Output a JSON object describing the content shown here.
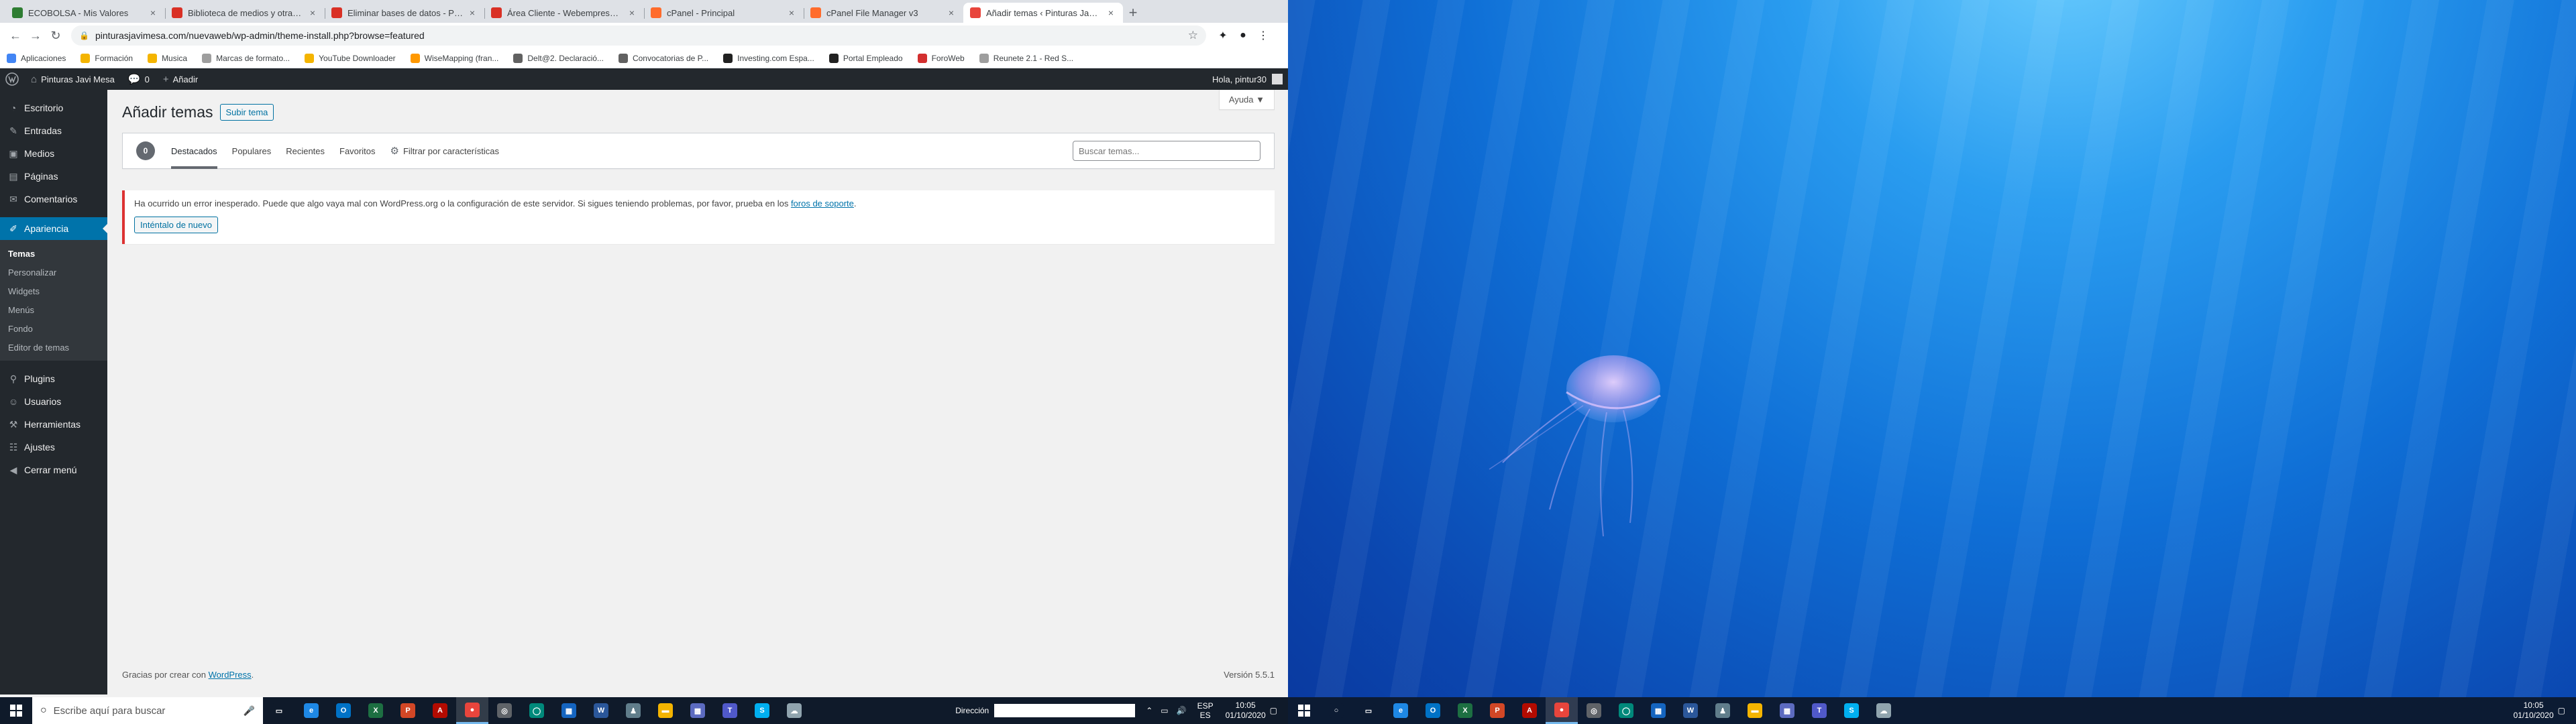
{
  "browser": {
    "tabs": [
      {
        "title": "ECOBOLSA - Mis Valores",
        "color": "#2e7d32"
      },
      {
        "title": "Biblioteca de medios y otras fu...",
        "color": "#d93025"
      },
      {
        "title": "Eliminar bases de datos - Pregu...",
        "color": "#d93025"
      },
      {
        "title": "Área Cliente - Webempresa Eur...",
        "color": "#d93025"
      },
      {
        "title": "cPanel - Principal",
        "color": "#ff6c2c"
      },
      {
        "title": "cPanel File Manager v3",
        "color": "#ff6c2c"
      },
      {
        "title": "Añadir temas ‹ Pinturas Javi Me...",
        "color": "#e8453c"
      }
    ],
    "active_tab_index": 6,
    "new_tab": "+",
    "url": "pinturasjavimesa.com/nuevaweb/wp-admin/theme-install.php?browse=featured",
    "bookmarks": [
      {
        "label": "Aplicaciones",
        "color": "#4285f4"
      },
      {
        "label": "Formación",
        "color": "#f4b400"
      },
      {
        "label": "Musica",
        "color": "#f4b400"
      },
      {
        "label": "Marcas de formato...",
        "color": "#9e9e9e"
      },
      {
        "label": "YouTube Downloader",
        "color": "#f4b400"
      },
      {
        "label": "WiseMapping (fran...",
        "color": "#ff9800"
      },
      {
        "label": "Delt@2. Declaració...",
        "color": "#616161"
      },
      {
        "label": "Convocatorias de P...",
        "color": "#616161"
      },
      {
        "label": "Investing.com Espa...",
        "color": "#212121"
      },
      {
        "label": "Portal Empleado",
        "color": "#212121"
      },
      {
        "label": "ForoWeb",
        "color": "#d32f2f"
      },
      {
        "label": "Reunete 2.1 - Red S...",
        "color": "#9e9e9e"
      }
    ]
  },
  "adminbar": {
    "site_name": "Pinturas Javi Mesa",
    "comments_count": "0",
    "new_label": "Añadir",
    "howdy": "Hola, pintur30"
  },
  "menu": {
    "items_top": [
      {
        "label": "Escritorio",
        "icon": "◔"
      },
      {
        "label": "Entradas",
        "icon": "✎"
      },
      {
        "label": "Medios",
        "icon": "▣"
      },
      {
        "label": "Páginas",
        "icon": "▤"
      },
      {
        "label": "Comentarios",
        "icon": "✉"
      }
    ],
    "current": {
      "label": "Apariencia",
      "icon": "✐"
    },
    "submenu": [
      "Temas",
      "Personalizar",
      "Widgets",
      "Menús",
      "Fondo",
      "Editor de temas"
    ],
    "items_bottom": [
      {
        "label": "Plugins",
        "icon": "⚲"
      },
      {
        "label": "Usuarios",
        "icon": "☺"
      },
      {
        "label": "Herramientas",
        "icon": "⚒"
      },
      {
        "label": "Ajustes",
        "icon": "☷"
      },
      {
        "label": "Cerrar menú",
        "icon": "◀"
      }
    ]
  },
  "page": {
    "help": "Ayuda ▼",
    "title": "Añadir temas",
    "upload_button": "Subir tema",
    "count": "0",
    "filters": [
      "Destacados",
      "Populares",
      "Recientes",
      "Favoritos"
    ],
    "feature_filter": "Filtrar por características",
    "search_placeholder": "Buscar temas...",
    "notice_text_1": "Ha ocurrido un error inesperado. Puede que algo vaya mal con WordPress.org o la configuración de este servidor. Si sigues teniendo problemas, por favor, prueba en los ",
    "notice_link": "foros de soporte",
    "notice_text_2": ".",
    "retry_button": "Inténtalo de nuevo",
    "footer_text": "Gracias por crear con ",
    "footer_link": "WordPress",
    "footer_dot": ".",
    "version": "Versión 5.5.1"
  },
  "taskbar": {
    "search_placeholder": "Escribe aquí para buscar",
    "apps_left": [
      {
        "name": "task-view",
        "label": "▭",
        "color": "#0f1a2a"
      },
      {
        "name": "edge",
        "label": "e",
        "color": "#1e88e5"
      },
      {
        "name": "outlook",
        "label": "O",
        "color": "#0072c6"
      },
      {
        "name": "excel",
        "label": "X",
        "color": "#1d6f42"
      },
      {
        "name": "powerpoint",
        "label": "P",
        "color": "#d24726"
      },
      {
        "name": "acrobat",
        "label": "A",
        "color": "#b30b00"
      },
      {
        "name": "chrome",
        "label": "●",
        "color": "#e8453c"
      },
      {
        "name": "app-8",
        "label": "◎",
        "color": "#5f6368"
      },
      {
        "name": "app-9",
        "label": "◯",
        "color": "#00897b"
      },
      {
        "name": "calendar",
        "label": "▦",
        "color": "#1565c0"
      },
      {
        "name": "word",
        "label": "W",
        "color": "#2b579a"
      },
      {
        "name": "app-12",
        "label": "♟",
        "color": "#607d8b"
      },
      {
        "name": "file-explorer",
        "label": "▬",
        "color": "#f4b400"
      },
      {
        "name": "app-14",
        "label": "▩",
        "color": "#5c6bc0"
      },
      {
        "name": "teams",
        "label": "T",
        "color": "#5059c9"
      },
      {
        "name": "skype",
        "label": "S",
        "color": "#00aff0"
      },
      {
        "name": "app-17",
        "label": "☁",
        "color": "#90a4ae"
      }
    ],
    "active_index": 6,
    "address_label": "Dirección",
    "lang_1": "ESP",
    "lang_2": "ES",
    "time": "10:05",
    "date": "01/10/2020",
    "apps_right": [
      {
        "name": "cortana",
        "label": "○",
        "color": "#0c1b33"
      },
      {
        "name": "task-view",
        "label": "▭",
        "color": "#0c1b33"
      },
      {
        "name": "edge",
        "label": "e",
        "color": "#1e88e5"
      },
      {
        "name": "outlook",
        "label": "O",
        "color": "#0072c6"
      },
      {
        "name": "excel",
        "label": "X",
        "color": "#1d6f42"
      },
      {
        "name": "powerpoint",
        "label": "P",
        "color": "#d24726"
      },
      {
        "name": "acrobat",
        "label": "A",
        "color": "#b30b00"
      },
      {
        "name": "chrome",
        "label": "●",
        "color": "#e8453c"
      },
      {
        "name": "app-9",
        "label": "◎",
        "color": "#5f6368"
      },
      {
        "name": "app-10",
        "label": "◯",
        "color": "#00897b"
      },
      {
        "name": "calendar",
        "label": "▦",
        "color": "#1565c0"
      },
      {
        "name": "word",
        "label": "W",
        "color": "#2b579a"
      },
      {
        "name": "app-13",
        "label": "♟",
        "color": "#607d8b"
      },
      {
        "name": "file-explorer",
        "label": "▬",
        "color": "#f4b400"
      },
      {
        "name": "app-15",
        "label": "▩",
        "color": "#5c6bc0"
      },
      {
        "name": "teams",
        "label": "T",
        "color": "#5059c9"
      },
      {
        "name": "skype",
        "label": "S",
        "color": "#00aff0"
      },
      {
        "name": "app-18",
        "label": "☁",
        "color": "#90a4ae"
      }
    ],
    "right_active_index": 7
  }
}
